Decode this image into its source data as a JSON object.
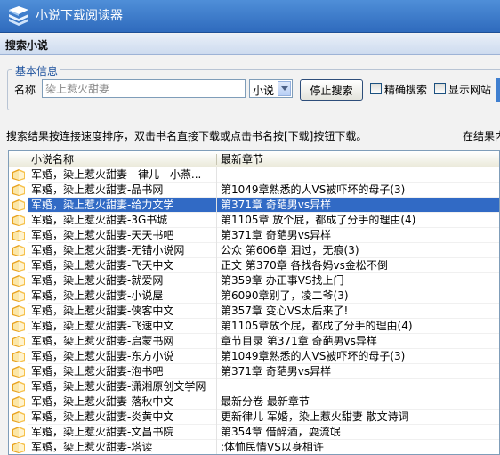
{
  "app": {
    "title": "小说下载阅读器"
  },
  "section": {
    "title": "搜索小说"
  },
  "basic_info": {
    "legend": "基本信息",
    "name_label": "名称",
    "name_value": "染上惹火甜妻",
    "type_select": "小说",
    "stop_button": "停止搜索",
    "exact_label": "精确搜索",
    "show_site_label": "显示网站"
  },
  "info": {
    "text": "搜索结果按连接速度排序，双击书名直接下载或点击书名按[下载]按钮下载。",
    "right_text": "在结果内"
  },
  "list": {
    "columns": [
      "小说名称",
      "最新章节"
    ],
    "rows": [
      {
        "name": "军婚，染上惹火甜妻 - 律儿 - 小燕...",
        "chapter": "",
        "selected": false
      },
      {
        "name": "军婚，染上惹火甜妻-品书网",
        "chapter": "第1049章熟悉的人VS被吓坏的母子(3)",
        "selected": false
      },
      {
        "name": "军婚，染上惹火甜妻-给力文学",
        "chapter": "第371章 奇葩男vs异样",
        "selected": true
      },
      {
        "name": "军婚，染上惹火甜妻-3G书城",
        "chapter": "第1105章 放个屁，都成了分手的理由(4)",
        "selected": false
      },
      {
        "name": "军婚，染上惹火甜妻-天天书吧",
        "chapter": "第371章 奇葩男vs异样",
        "selected": false
      },
      {
        "name": "军婚，染上惹火甜妻-无错小说网",
        "chapter": "公众 第606章 泪过，无痕(3)",
        "selected": false
      },
      {
        "name": "军婚，染上惹火甜妻-飞天中文",
        "chapter": "正文 第370章 各找各妈vs金松不倒",
        "selected": false
      },
      {
        "name": "军婚，染上惹火甜妻-就爱网",
        "chapter": "第359章 办正事VS找上门",
        "selected": false
      },
      {
        "name": "军婚，染上惹火甜妻-小说屋",
        "chapter": "第6090章别了，凌二爷(3)",
        "selected": false
      },
      {
        "name": "军婚，染上惹火甜妻-侠客中文",
        "chapter": "第357章 变心VS太后来了!",
        "selected": false
      },
      {
        "name": "军婚，染上惹火甜妻-飞速中文",
        "chapter": "第1105章放个屁，都成了分手的理由(4)",
        "selected": false
      },
      {
        "name": "军婚，染上惹火甜妻-启蒙书网",
        "chapter": "章节目录 第371章 奇葩男vs异样",
        "selected": false
      },
      {
        "name": "军婚，染上惹火甜妻-东方小说",
        "chapter": "第1049章熟悉的人VS被吓坏的母子(3)",
        "selected": false
      },
      {
        "name": "军婚，染上惹火甜妻-泡书吧",
        "chapter": "第371章 奇葩男vs异样",
        "selected": false
      },
      {
        "name": "军婚，染上惹火甜妻-潇湘原创文学网",
        "chapter": "",
        "selected": false
      },
      {
        "name": "军婚，染上惹火甜妻-落秋中文",
        "chapter": "最新分卷 最新章节",
        "selected": false
      },
      {
        "name": "军婚，染上惹火甜妻-炎黄中文",
        "chapter": "更新律儿 军婚，染上惹火甜妻 散文诗词",
        "selected": false
      },
      {
        "name": "军婚，染上惹火甜妻-文昌书院",
        "chapter": "第354章 借醉酒，耍流氓",
        "selected": false
      },
      {
        "name": "军婚，染上惹火甜妻-塔读",
        "chapter": ":体恤民情VS以身相许",
        "selected": false
      }
    ]
  },
  "colors": {
    "titlebar": "#3a78c9",
    "selection": "#316ac5",
    "accent": "#1a4f9c"
  }
}
